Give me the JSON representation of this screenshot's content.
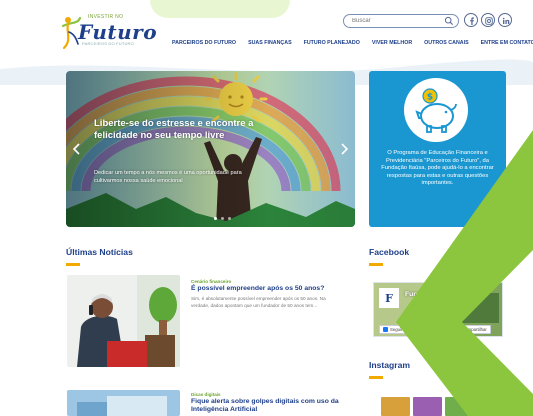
{
  "header": {
    "logo_small": "INVESTIR NO",
    "logo_text": "Futuro",
    "logo_tagline": "PARCEIROS DO FUTURO",
    "search": {
      "placeholder": "Buscar"
    },
    "nav": [
      {
        "label": "PARCEIROS DO FUTURO"
      },
      {
        "label": "SUAS FINANÇAS"
      },
      {
        "label": "FUTURO PLANEJADO"
      },
      {
        "label": "VIVER MELHOR"
      },
      {
        "label": "OUTROS CANAIS"
      },
      {
        "label": "ENTRE EM CONTATO"
      }
    ],
    "social": [
      {
        "name": "facebook-icon"
      },
      {
        "name": "instagram-icon"
      },
      {
        "name": "linkedin-icon"
      }
    ]
  },
  "hero": {
    "title": "Liberte-se do estresse e encontre a felicidade no seu tempo livre",
    "description": "Dedicar um tempo a nós mesmos é uma oportunidade para cultivarmos nossa saúde emocional"
  },
  "promo": {
    "text": "O Programa de Educação Financeira e Previdenciária \"Parceiros do Futuro\", da Fundação Itaúsa, pode ajudá-lo a encontrar respostas para estas e outras questões importantes."
  },
  "news": {
    "heading": "Últimas Notícias",
    "items": [
      {
        "category": "Cenário financeiro",
        "title": "É possível empreender após os 50 anos?",
        "excerpt": "Sim, é absolutamente possível empreender após os 50 anos. Na verdade, dados apontam que um fundador de 50 anos tem..."
      },
      {
        "category": "Dicas digitais",
        "title": "Fique alerta sobre golpes digitais com uso da Inteligência Artificial",
        "excerpt": ""
      }
    ]
  },
  "facebook": {
    "heading": "Facebook",
    "page_name": "Fundação Itaúsa In...",
    "follow_label": "Seguir Página",
    "share_label": "Compartilhar"
  },
  "instagram": {
    "heading": "Instagram"
  },
  "colors": {
    "brand_blue": "#1e3f8a",
    "accent_yellow": "#f2a900",
    "accent_green": "#8cc63f",
    "promo_blue": "#1a97d1"
  }
}
